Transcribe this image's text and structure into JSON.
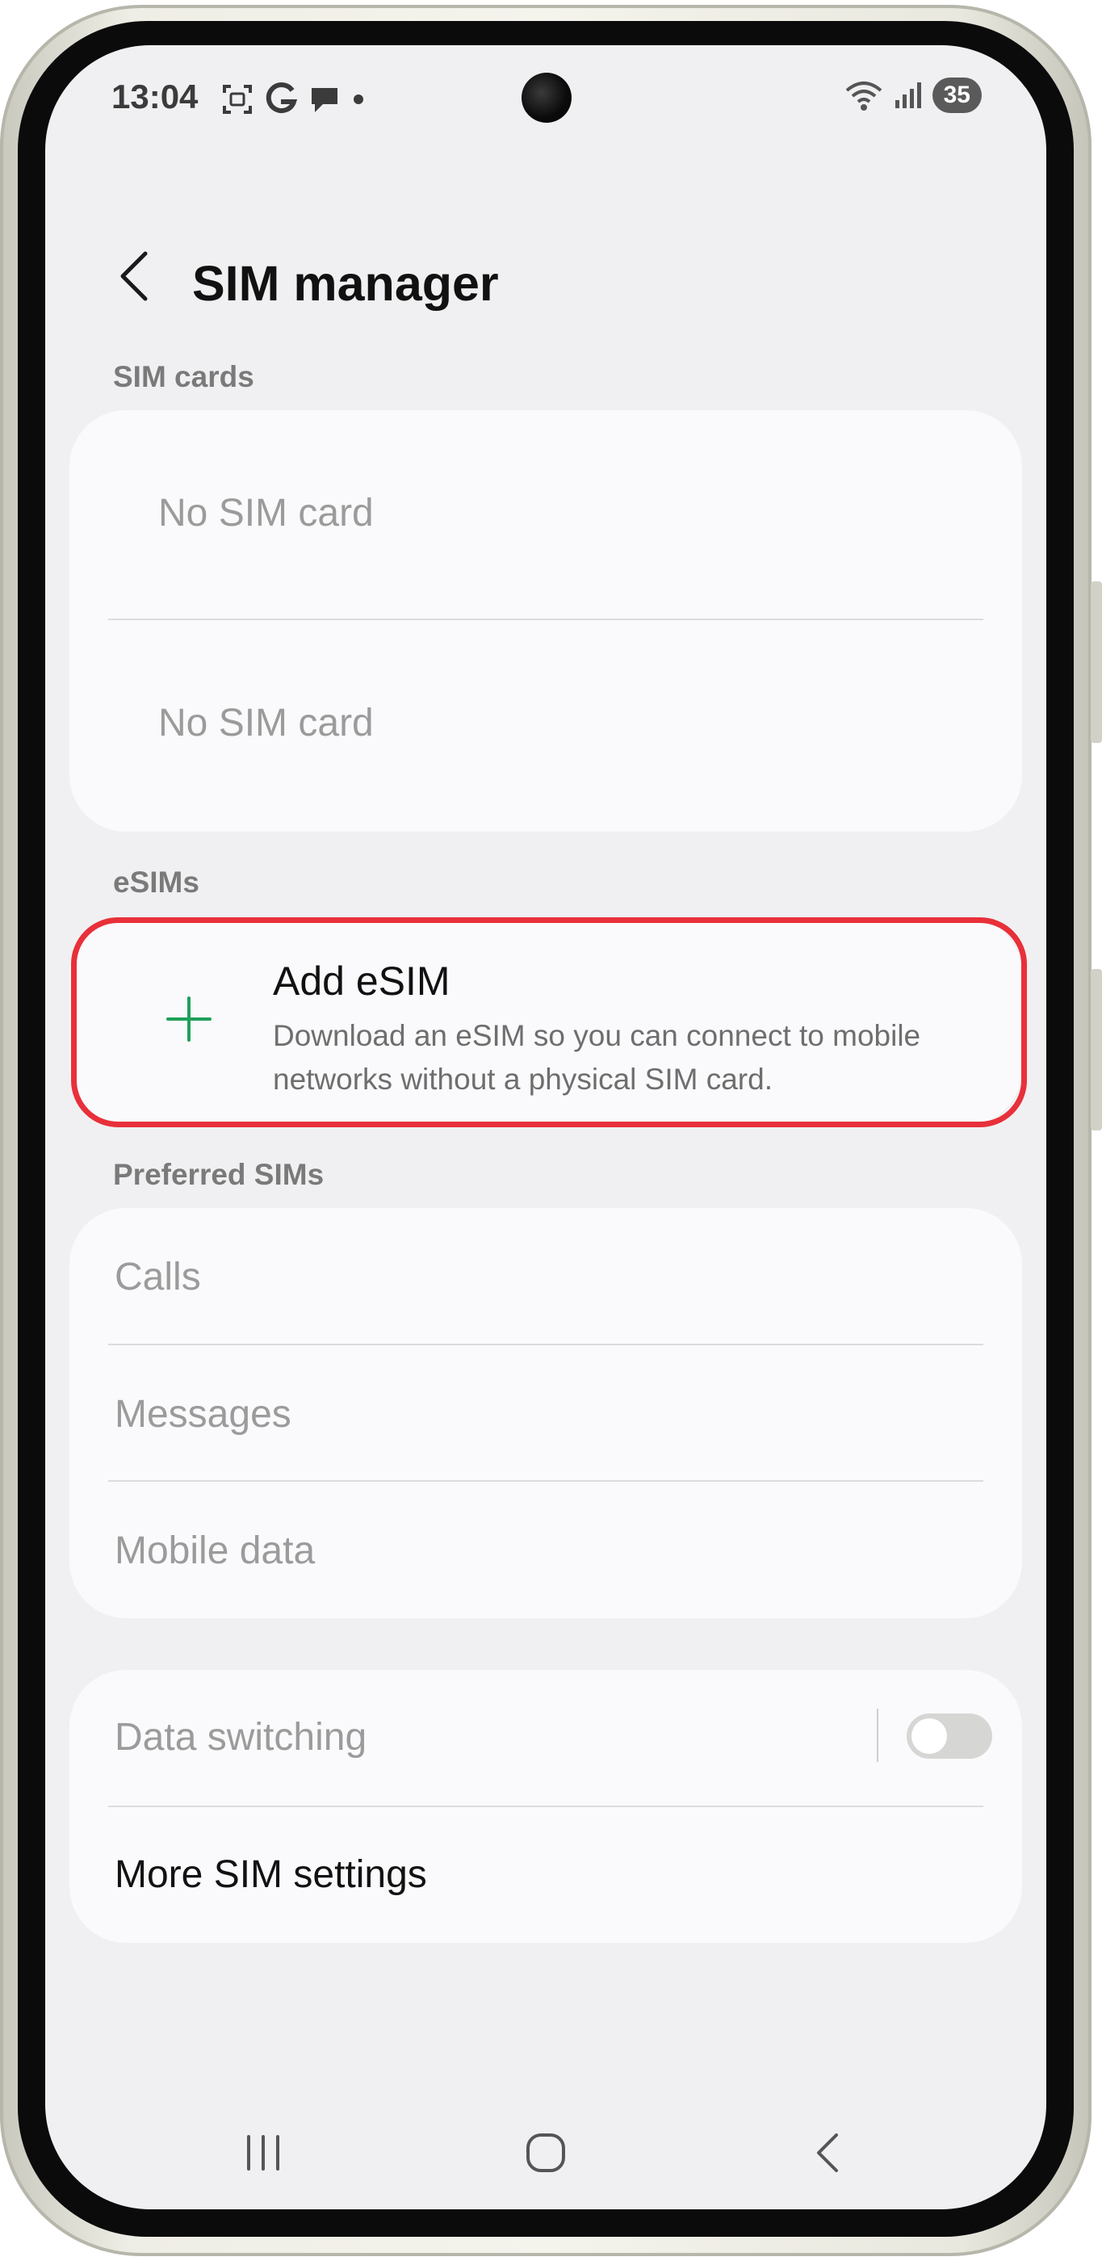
{
  "status_bar": {
    "time": "13:04",
    "left_icons": [
      "screenshot-icon",
      "google-icon",
      "chat-icon",
      "dot-icon"
    ],
    "right_icons": [
      "wifi-icon",
      "signal-icon"
    ],
    "battery": "35"
  },
  "header": {
    "title": "SIM manager",
    "back_icon": "chevron-left-icon"
  },
  "sim_cards": {
    "section_label": "SIM cards",
    "slots": [
      "No SIM card",
      "No SIM card"
    ]
  },
  "esims": {
    "section_label": "eSIMs",
    "add_title": "Add eSIM",
    "add_description": "Download an eSIM so you can connect to mobile networks without a physical SIM card.",
    "add_icon": "plus-icon",
    "accent_color": "#1fa05a",
    "highlight_color": "#e8303a"
  },
  "preferred_sims": {
    "section_label": "Preferred SIMs",
    "items": [
      "Calls",
      "Messages",
      "Mobile data"
    ]
  },
  "other": {
    "data_switching_label": "Data switching",
    "data_switching_enabled": false,
    "more_settings_label": "More SIM settings"
  },
  "nav_bar": {
    "icons": [
      "recents-icon",
      "home-icon",
      "back-icon"
    ]
  }
}
